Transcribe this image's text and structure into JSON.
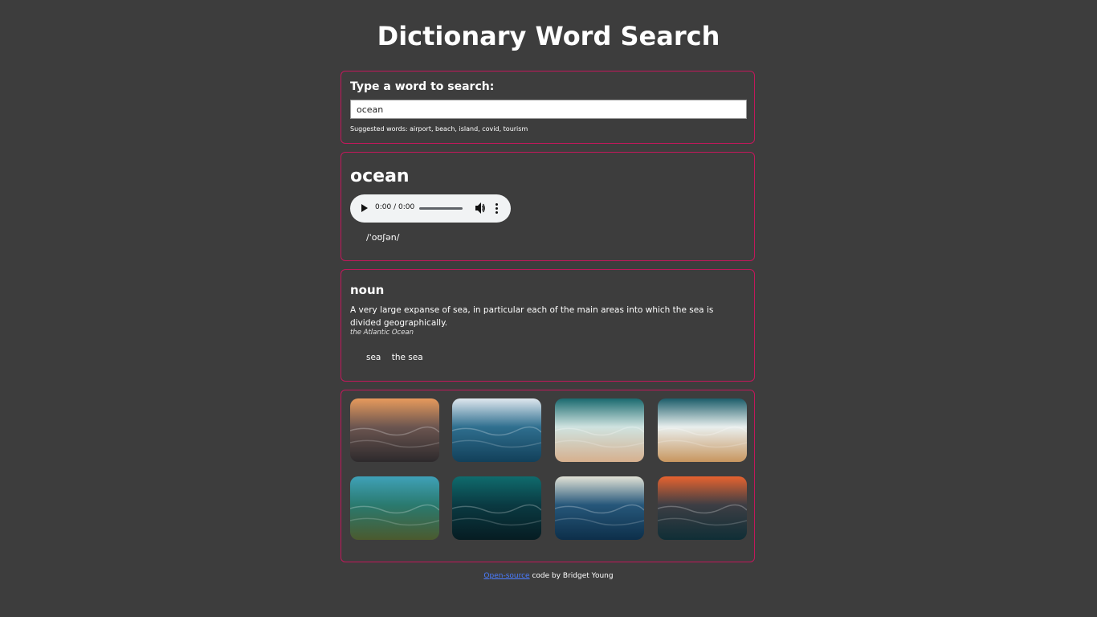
{
  "page": {
    "title": "Dictionary Word Search"
  },
  "search": {
    "label": "Type a word to search:",
    "value": "ocean",
    "suggested_label": "Suggested words: airport, beach, island, covid, tourism"
  },
  "word": {
    "text": "ocean",
    "audio_time": "0:00 / 0:00",
    "phonetic": "/ˈoʊʃən/"
  },
  "meaning": {
    "part_of_speech": "noun",
    "definition": "A very large expanse of sea, in particular each of the main areas into which the sea is divided geographically.",
    "example": "the Atlantic Ocean",
    "synonyms": [
      "sea",
      "the sea"
    ]
  },
  "photos": [
    {
      "name": "sunset-waves-photo",
      "colors": [
        "#e79a5c",
        "#6b5550",
        "#2d2a2c"
      ]
    },
    {
      "name": "open-ocean-photo",
      "colors": [
        "#dfe7ee",
        "#2f6f8f",
        "#12405a"
      ]
    },
    {
      "name": "aerial-surf-photo",
      "colors": [
        "#1a6a6f",
        "#cfe3e0",
        "#d6b08e"
      ]
    },
    {
      "name": "aerial-beach-photo",
      "colors": [
        "#1c5d6a",
        "#e9efee",
        "#c8965f"
      ]
    },
    {
      "name": "sea-turtle-photo",
      "colors": [
        "#3fa1b8",
        "#2a7a6f",
        "#4b5a2e"
      ]
    },
    {
      "name": "underwater-rays-photo",
      "colors": [
        "#0f6b6d",
        "#0a3a42",
        "#061c22"
      ]
    },
    {
      "name": "stormy-sea-photo",
      "colors": [
        "#e2e2d6",
        "#26577a",
        "#0d2f4a"
      ]
    },
    {
      "name": "red-sunset-sea-photo",
      "colors": [
        "#e7632f",
        "#3d3e44",
        "#0f2e36"
      ]
    }
  ],
  "footer": {
    "link_text": "Open-source",
    "text": " code by Bridget Young"
  }
}
